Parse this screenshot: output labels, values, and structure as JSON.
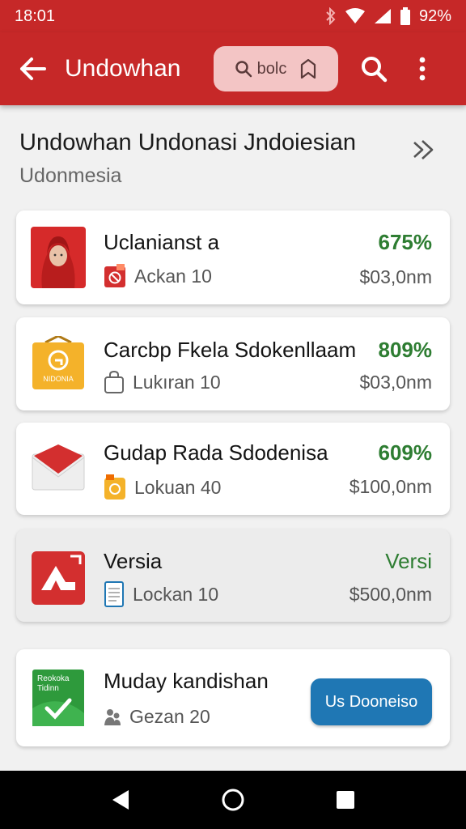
{
  "status_bar": {
    "time": "18:01",
    "battery": "92%"
  },
  "app_bar": {
    "title": "Undowhan",
    "search_text": "bolc"
  },
  "header": {
    "title": "Undowhan Undonasi Jndoiesian",
    "subtitle": "Udonmesia"
  },
  "items": [
    {
      "name": "Uclanianst a",
      "percent": "675%",
      "sub": "Ackan 10",
      "amount": "$03,0nm",
      "thumb_icon": "person-in-hijab-icon",
      "sub_icon": "no-sign-icon"
    },
    {
      "name": "Carcbp Fkela Sdokenllaam",
      "percent": "809%",
      "sub": "Lukıran 10",
      "amount": "$03,0nm",
      "thumb_icon": "nidonia-box-icon",
      "thumb_text": "NIDONIA",
      "sub_icon": "bag-icon"
    },
    {
      "name": "Gudap Rada Sdodenisa",
      "percent": "609%",
      "sub": "Lokuan 40",
      "amount": "$100,0nm",
      "thumb_icon": "mail-envelope-icon",
      "sub_icon": "orange-badge-icon"
    },
    {
      "name": "Versia",
      "percent": "Versi",
      "sub": "Lockan 10",
      "amount": "$500,0nm",
      "thumb_icon": "app-logo-icon",
      "sub_icon": "document-icon"
    },
    {
      "name": "Muday kandishan",
      "sub": "Gezan 20",
      "button": "Us Dooneiso",
      "thumb_icon": "green-book-icon",
      "thumb_text_line1": "Reokoka",
      "thumb_text_line2": "Tidinn",
      "sub_icon": "people-icon"
    }
  ],
  "colors": {
    "primary": "#c62828",
    "accent_green": "#2e7d32",
    "button_blue": "#1f77b4"
  }
}
